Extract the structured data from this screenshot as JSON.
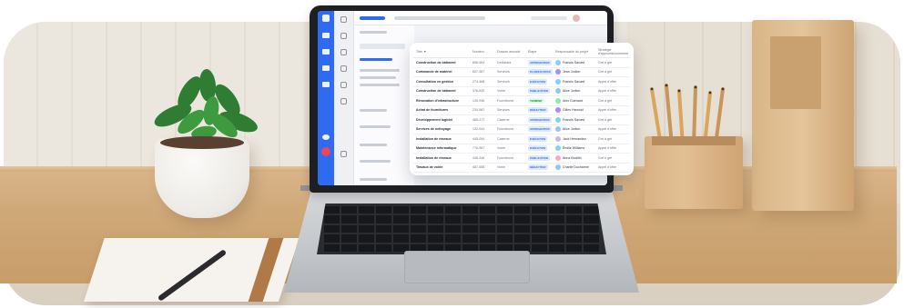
{
  "scene": {
    "laptop_screen_sidebar_badge_color": "#e9475a",
    "app_accent": "#2f6bf0"
  },
  "table": {
    "headers": {
      "title": "Titre ▼",
      "number": "Numéro",
      "domain": "Dossier associé",
      "status": "Étape",
      "owner": "Responsable du projet",
      "stage": "Stratégie d'approvisionnement"
    },
    "rows": [
      {
        "title": "Construction de bâtiment",
        "number": "856-564",
        "domain": "Déclarant",
        "status": "APPROBATION",
        "status_color": "#2563eb",
        "status_bg": "#dbeafe",
        "owner": "Francis Savard",
        "avatar_color": "#7dd3fc",
        "stage": "Gré à gré"
      },
      {
        "title": "Commande de matériel",
        "number": "657-387",
        "domain": "Services",
        "status": "PLANIFICATION",
        "status_color": "#2563eb",
        "status_bg": "#dbeafe",
        "owner": "Jean Jodion",
        "avatar_color": "#a78bfa",
        "stage": "Gré à gré"
      },
      {
        "title": "Consultation en gestion",
        "number": "274-468",
        "domain": "Services",
        "status": "EXÉCUTION",
        "status_color": "#2563eb",
        "status_bg": "#dbeafe",
        "owner": "Francis Savard",
        "avatar_color": "#7dd3fc",
        "stage": "Appel d'offre"
      },
      {
        "title": "Construction de bâtiment",
        "number": "376-640",
        "domain": "Voirie",
        "status": "PUBLICATION",
        "status_color": "#2563eb",
        "status_bg": "#dbeafe",
        "owner": "Alice Jodion",
        "avatar_color": "#93c5fd",
        "stage": "Appel d'offre"
      },
      {
        "title": "Rénovation d'infrastructure",
        "number": "130-946",
        "domain": "Fournitures",
        "status": "TERMINÉ",
        "status_color": "#15803d",
        "status_bg": "#dcfce7",
        "owner": "Alex Guénard",
        "avatar_color": "#86efac",
        "stage": "Gré à gré"
      },
      {
        "title": "Achat de fournitures",
        "number": "234-987",
        "domain": "Services",
        "status": "RÉDACTION",
        "status_color": "#2563eb",
        "status_bg": "#dbeafe",
        "owner": "Gilles Harnold",
        "avatar_color": "#a78bfa",
        "stage": "Appel d'offre"
      },
      {
        "title": "Développement logiciel",
        "number": "485-377",
        "domain": "Caserne",
        "status": "APPROBATION",
        "status_color": "#2563eb",
        "status_bg": "#dbeafe",
        "owner": "Francis Savard",
        "avatar_color": "#7dd3fc",
        "stage": "Gré à gré"
      },
      {
        "title": "Services de nettoyage",
        "number": "132-944",
        "domain": "Fournitures",
        "status": "APPROBATION",
        "status_color": "#2563eb",
        "status_bg": "#dbeafe",
        "owner": "Alice Jodion",
        "avatar_color": "#93c5fd",
        "stage": "Appel d'offre"
      },
      {
        "title": "Installation de réseaux",
        "number": "445-094",
        "domain": "Caserne",
        "status": "EXÉCUTION",
        "status_color": "#2563eb",
        "status_bg": "#dbeafe",
        "owner": "Jack Hernandez",
        "avatar_color": "#c4b5fd",
        "stage": "Gré à gré"
      },
      {
        "title": "Maintenance informatique",
        "number": "776-987",
        "domain": "Voirie",
        "status": "EXÉCUTION",
        "status_color": "#2563eb",
        "status_bg": "#dbeafe",
        "owner": "Émilie Williams",
        "avatar_color": "#7dd3fc",
        "stage": "Appel d'offre"
      },
      {
        "title": "Installation de réseaux",
        "number": "446-946",
        "domain": "Fournitures",
        "status": "PUBLICATION",
        "status_color": "#2563eb",
        "status_bg": "#dbeafe",
        "owner": "Anna Boddin",
        "avatar_color": "#f9a8d4",
        "stage": "Gré à gré"
      },
      {
        "title": "Travaux de voirie",
        "number": "487-558",
        "domain": "Voirie",
        "status": "RÉDACTION",
        "status_color": "#2563eb",
        "status_bg": "#dbeafe",
        "owner": "Charlie Ducharme",
        "avatar_color": "#93c5fd",
        "stage": "Appel d'offre"
      }
    ]
  }
}
